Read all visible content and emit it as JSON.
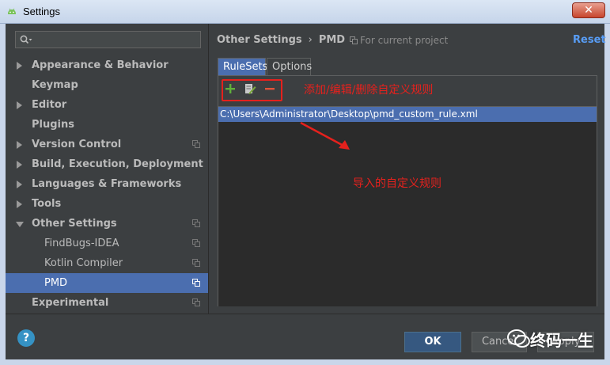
{
  "window": {
    "title": "Settings",
    "close_label": "✕"
  },
  "search": {
    "placeholder": ""
  },
  "sidebar": {
    "items": [
      {
        "label": "Appearance & Behavior",
        "bold": true,
        "arrow": "right",
        "copy": false,
        "indent": 0,
        "selected": false
      },
      {
        "label": "Keymap",
        "bold": true,
        "arrow": "none",
        "copy": false,
        "indent": 0,
        "selected": false
      },
      {
        "label": "Editor",
        "bold": true,
        "arrow": "right",
        "copy": false,
        "indent": 0,
        "selected": false
      },
      {
        "label": "Plugins",
        "bold": true,
        "arrow": "none",
        "copy": false,
        "indent": 0,
        "selected": false
      },
      {
        "label": "Version Control",
        "bold": true,
        "arrow": "right",
        "copy": true,
        "indent": 0,
        "selected": false
      },
      {
        "label": "Build, Execution, Deployment",
        "bold": true,
        "arrow": "right",
        "copy": false,
        "indent": 0,
        "selected": false
      },
      {
        "label": "Languages & Frameworks",
        "bold": true,
        "arrow": "right",
        "copy": false,
        "indent": 0,
        "selected": false
      },
      {
        "label": "Tools",
        "bold": true,
        "arrow": "right",
        "copy": false,
        "indent": 0,
        "selected": false
      },
      {
        "label": "Other Settings",
        "bold": true,
        "arrow": "down",
        "copy": true,
        "indent": 0,
        "selected": false
      },
      {
        "label": "FindBugs-IDEA",
        "bold": false,
        "arrow": "none",
        "copy": true,
        "indent": 1,
        "selected": false
      },
      {
        "label": "Kotlin Compiler",
        "bold": false,
        "arrow": "none",
        "copy": true,
        "indent": 1,
        "selected": false
      },
      {
        "label": "PMD",
        "bold": false,
        "arrow": "none",
        "copy": true,
        "indent": 1,
        "selected": true
      },
      {
        "label": "Experimental",
        "bold": true,
        "arrow": "none",
        "copy": true,
        "indent": 0,
        "selected": false
      }
    ]
  },
  "header": {
    "crumb1": "Other Settings",
    "separator": "›",
    "crumb2": "PMD",
    "scope": "For current project",
    "reset": "Reset"
  },
  "tabs": [
    {
      "label": "RuleSets",
      "active": true
    },
    {
      "label": "Options",
      "active": false
    }
  ],
  "toolbar": {
    "add": "+",
    "remove": "−"
  },
  "annotations": {
    "toolbar_note": "添加/编辑/删除自定义规则",
    "list_note": "导入的自定义规则"
  },
  "rulesets": {
    "items": [
      "C:\\Users\\Administrator\\Desktop\\pmd_custom_rule.xml"
    ]
  },
  "footer": {
    "help": "?",
    "ok": "OK",
    "cancel": "Cancel",
    "apply": "Apply"
  },
  "watermark": {
    "text": "终码一生"
  },
  "colors": {
    "accent": "#4b6eaf",
    "link": "#589df6",
    "annotation": "#e5211d",
    "background": "#3c3f41"
  }
}
